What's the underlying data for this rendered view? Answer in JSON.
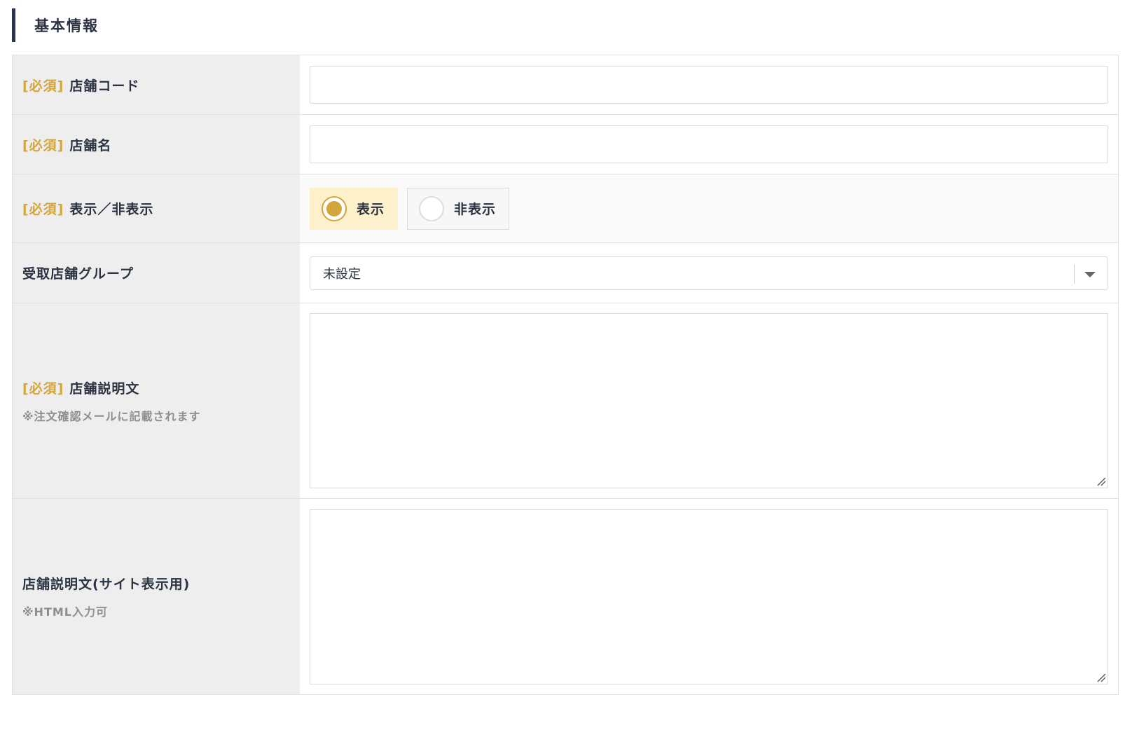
{
  "section": {
    "title": "基本情報"
  },
  "required_marker": "[必須]",
  "fields": {
    "store_code": {
      "label": "店舗コード",
      "value": ""
    },
    "store_name": {
      "label": "店舗名",
      "value": ""
    },
    "visibility": {
      "label": "表示／非表示",
      "options": [
        "表示",
        "非表示"
      ],
      "selected": "表示"
    },
    "pickup_group": {
      "label": "受取店舗グループ",
      "selected": "未設定"
    },
    "description": {
      "label": "店舗説明文",
      "note": "※注文確認メールに記載されます",
      "value": ""
    },
    "site_description": {
      "label": "店舗説明文(サイト表示用)",
      "note": "※HTML入力可",
      "value": ""
    }
  },
  "colors": {
    "accent": "#d4a63a",
    "selected_bg": "#fdf1cc",
    "label_bg": "#eeeeee",
    "text": "#2b3343",
    "heading_bar": "#2b3450"
  }
}
